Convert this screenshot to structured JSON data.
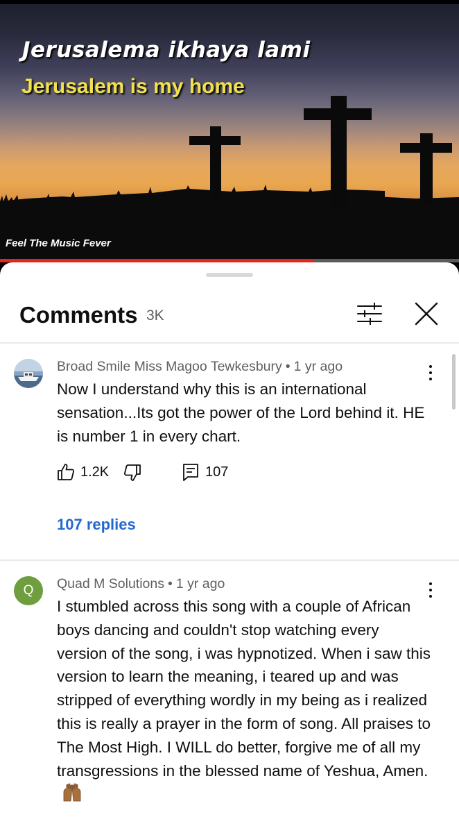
{
  "video": {
    "title_line_1": "Jerusalema ikhaya lami",
    "title_line_2": "Jerusalem is my home",
    "channel_watermark": "Feel The Music Fever",
    "progress_fraction": 0.685
  },
  "comments_panel": {
    "title": "Comments",
    "count": "3K",
    "filter_icon": "sliders-icon",
    "close_icon": "close-icon"
  },
  "comments": [
    {
      "author": "Broad Smile Miss Magoo Tewkesbury",
      "age": "1 yr ago",
      "text": "Now I understand why this is an international sensation...Its got the power of the Lord behind it. HE is number 1 in every chart.",
      "likes": "1.2K",
      "reply_count": "107",
      "replies_link": "107 replies",
      "avatar": "photo-avatar"
    },
    {
      "author": "Quad M Solutions",
      "age": "1 yr ago",
      "avatar_letter": "Q",
      "text": "I stumbled across this song with a couple of African boys dancing and couldn't stop watching every version of the song, i was hypnotized. When i saw this version to learn the meaning, i teared up and was stripped of everything wordly in my being as i realized this is really a prayer in the form of song.  All praises to The Most High. I WILL do better, forgive me of all my transgressions in the blessed name of Yeshua, Amen.",
      "emoji": "raised-hands-emoji"
    }
  ],
  "colors": {
    "accent_link": "#2368d0",
    "progress": "#e2271c",
    "avatar_q": "#6f9e3f",
    "title_yellow": "#f1e14c"
  }
}
